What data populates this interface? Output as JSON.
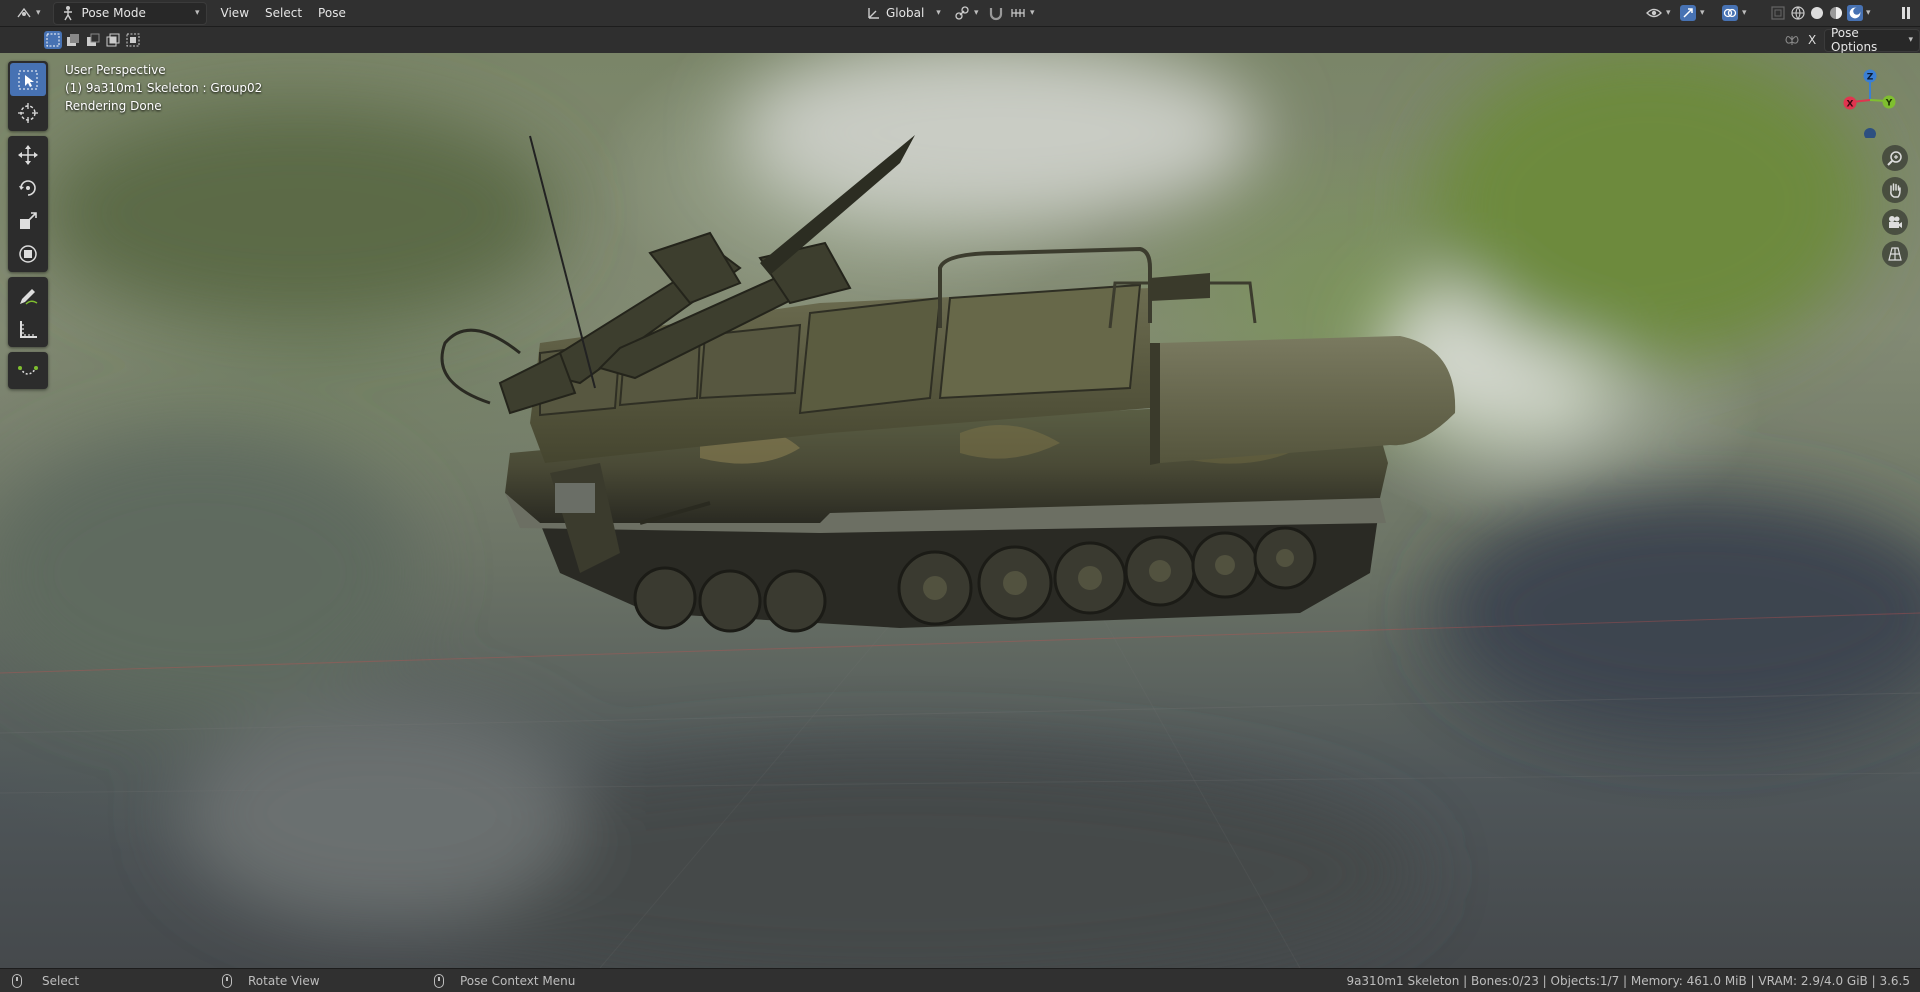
{
  "header": {
    "mode_label": "Pose Mode",
    "menus": [
      "View",
      "Select",
      "Pose"
    ],
    "transform_orientation": "Global",
    "pose_options_label": "Pose Options",
    "x_mirror_label": "X"
  },
  "viewport": {
    "perspective_label": "User Perspective",
    "object_label": "(1) 9a310m1 Skeleton : Group02",
    "render_status": "Rendering Done",
    "gizmo": {
      "z": "Z",
      "x": "X",
      "y": "Y"
    }
  },
  "statusbar": {
    "left_action": "Select",
    "middle_action": "Rotate View",
    "right_action": "Pose Context Menu",
    "stats": "9a310m1 Skeleton | Bones:0/23 | Objects:1/7 | Memory: 461.0 MiB | VRAM: 2.9/4.0 GiB | 3.6.5"
  },
  "colors": {
    "accent": "#4772b3",
    "header_bg": "#303030",
    "axis_x": "#e0354f",
    "axis_y": "#7fbf2f",
    "axis_z": "#3b7fd4"
  }
}
